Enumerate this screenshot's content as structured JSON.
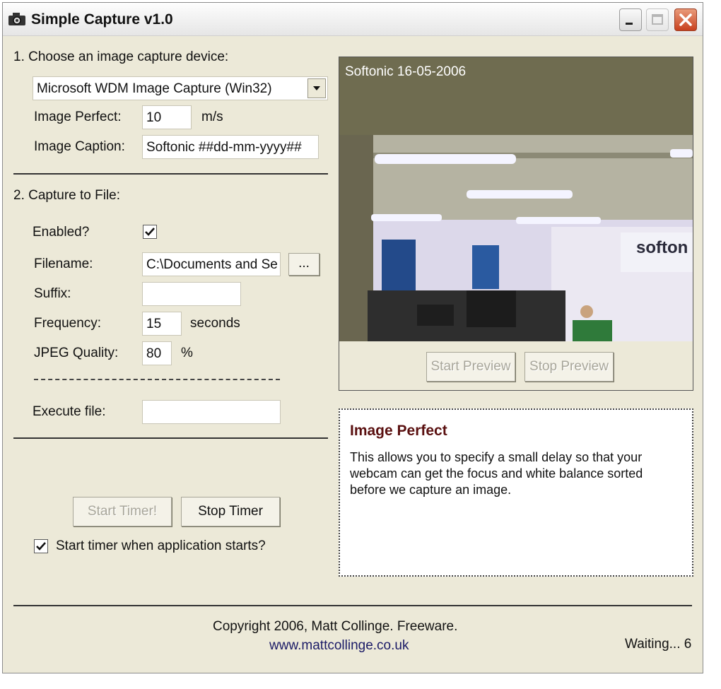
{
  "window": {
    "title": "Simple Capture v1.0"
  },
  "device_section": {
    "heading": "1. Choose an image capture device:",
    "device_selected": "Microsoft WDM Image Capture (Win32)",
    "image_perfect_label": "Image Perfect:",
    "image_perfect_value": "10",
    "image_perfect_unit": "m/s",
    "caption_label": "Image Caption:",
    "caption_value": "Softonic ##dd-mm-yyyy##"
  },
  "file_section": {
    "heading": "2. Capture to File:",
    "enabled_label": "Enabled?",
    "enabled_checked": true,
    "filename_label": "Filename:",
    "filename_value": "C:\\Documents and Se",
    "browse_label": "...",
    "suffix_label": "Suffix:",
    "suffix_value": "",
    "frequency_label": "Frequency:",
    "frequency_value": "15",
    "frequency_unit": "seconds",
    "jpeg_label": "JPEG Quality:",
    "jpeg_value": "80",
    "jpeg_unit": "%",
    "execute_label": "Execute file:",
    "execute_value": ""
  },
  "timer": {
    "start_label": "Start Timer!",
    "stop_label": "Stop Timer",
    "autostart_label": "Start timer when application starts?",
    "autostart_checked": true
  },
  "preview": {
    "overlay_caption": "Softonic 16-05-2006",
    "logo_text": "softon",
    "start_label": "Start Preview",
    "stop_label": "Stop Preview"
  },
  "help": {
    "title": "Image Perfect",
    "text": "This allows you to specify a small delay so that your webcam can get the focus and white balance sorted before we capture an image."
  },
  "footer": {
    "copyright": "Copyright 2006, Matt Collinge. Freeware.",
    "link": "www.mattcollinge.co.uk",
    "status": "Waiting... 6"
  },
  "colors": {
    "window_bg": "#ece9d8",
    "close_button": "#c8401e",
    "help_title": "#5a1010",
    "link": "#1a1a66"
  },
  "icons": {
    "app": "camera-icon",
    "minimize": "minimize-icon",
    "maximize": "maximize-icon",
    "close": "close-icon",
    "dropdown": "chevron-down-icon",
    "check": "checkmark-icon"
  }
}
